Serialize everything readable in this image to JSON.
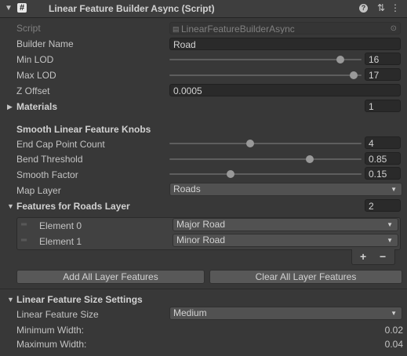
{
  "header": {
    "title": "Linear Feature Builder Async (Script)",
    "icons": [
      "help-icon",
      "presets-icon",
      "context-menu-icon"
    ]
  },
  "script": {
    "label": "Script",
    "value": "LinearFeatureBuilderAsync"
  },
  "builder_name": {
    "label": "Builder Name",
    "value": "Road"
  },
  "min_lod": {
    "label": "Min LOD",
    "value": "16",
    "level": 0.89
  },
  "max_lod": {
    "label": "Max LOD",
    "value": "17",
    "level": 0.96
  },
  "z_offset": {
    "label": "Z Offset",
    "value": "0.0005"
  },
  "materials": {
    "label": "Materials",
    "count": "1"
  },
  "knobs": {
    "title": "Smooth Linear Feature Knobs",
    "end_cap": {
      "label": "End Cap Point Count",
      "value": "4",
      "level": 0.42
    },
    "bend": {
      "label": "Bend Threshold",
      "value": "0.85",
      "level": 0.73
    },
    "smooth": {
      "label": "Smooth Factor",
      "value": "0.15",
      "level": 0.32
    },
    "map_layer": {
      "label": "Map Layer",
      "value": "Roads"
    }
  },
  "features": {
    "title": "Features for Roads Layer",
    "count": "2",
    "elements": [
      {
        "label": "Element 0",
        "value": "Major Road"
      },
      {
        "label": "Element 1",
        "value": "Minor Road"
      }
    ],
    "add_label": "+",
    "remove_label": "−"
  },
  "buttons": {
    "add_all": "Add All Layer Features",
    "clear_all": "Clear All Layer Features"
  },
  "size": {
    "title": "Linear Feature Size Settings",
    "size_label": "Linear Feature Size",
    "size_value": "Medium",
    "min_width_label": "Minimum Width:",
    "min_width_value": "0.02",
    "max_width_label": "Maximum Width:",
    "max_width_value": "0.04"
  },
  "colors": {
    "background": "#383838",
    "field": "#2a2a2a",
    "dropdown": "#515151",
    "button": "#585858"
  }
}
